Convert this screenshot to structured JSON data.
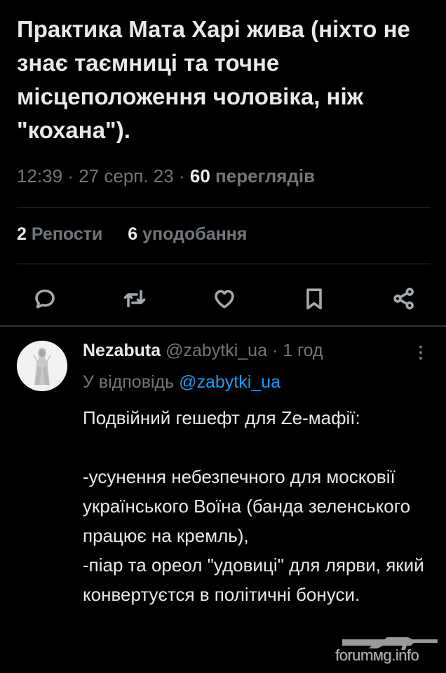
{
  "tweet": {
    "text": "Практика Мата Харі жива (ніхто не знає таємниці та точне місцеположення чоловіка, ніж \"кохана\").",
    "time": "12:39",
    "date": "27 серп. 23",
    "separator": "·",
    "views_count": "60",
    "views_label": "переглядів"
  },
  "stats": {
    "reposts_count": "2",
    "reposts_label": "Репости",
    "likes_count": "6",
    "likes_label": "уподобання"
  },
  "actions": [
    {
      "icon": "reply-icon"
    },
    {
      "icon": "repost-icon"
    },
    {
      "icon": "like-icon"
    },
    {
      "icon": "bookmark-icon"
    },
    {
      "icon": "share-icon"
    }
  ],
  "reply": {
    "name": "Nezabuta",
    "handle": "@zabytki_ua",
    "separator": "·",
    "time": "1 год",
    "reply_to_prefix": "У відповідь",
    "reply_to_handle": "@zabytki_ua",
    "lines": [
      "Подвійний гешефт для Ze-мафії:",
      "",
      "-усунення небезпечного для московії українського Воїна (банда зеленського працює на кремль),",
      "-піар та ореол \"удовиці\" для лярви, який конвертуєтся в політичні бонуси."
    ]
  },
  "watermark": {
    "text": "forumмg.info"
  },
  "colors": {
    "background": "#000000",
    "text": "#e7e9ea",
    "secondary": "#71767b",
    "link": "#1d9bf0",
    "divider": "#2f3336"
  }
}
